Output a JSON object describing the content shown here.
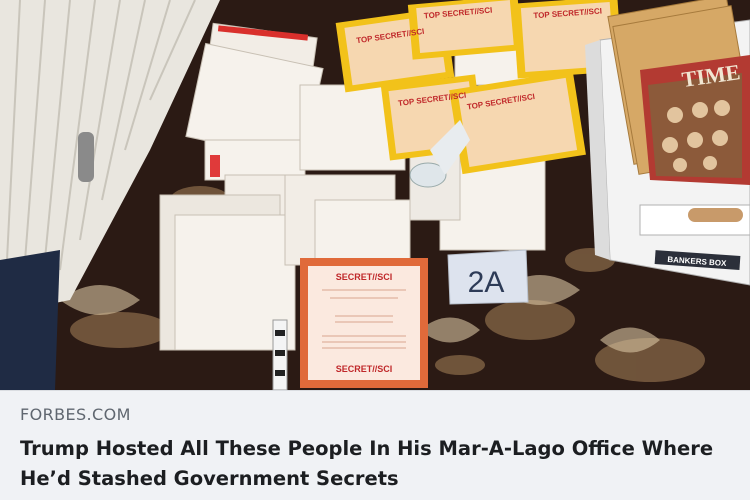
{
  "link_preview": {
    "source": "FORBES.COM",
    "title": "Trump Hosted All These People In His Mar-A-Lago Office Where He’d Stashed Government Secrets",
    "image": {
      "evidence_marker": "2A",
      "cover_labels": [
        "SECRET//SCI",
        "TOP SECRET//SCI"
      ],
      "box_label": "BANKERS BOX",
      "magazine_label": "TIME"
    }
  }
}
